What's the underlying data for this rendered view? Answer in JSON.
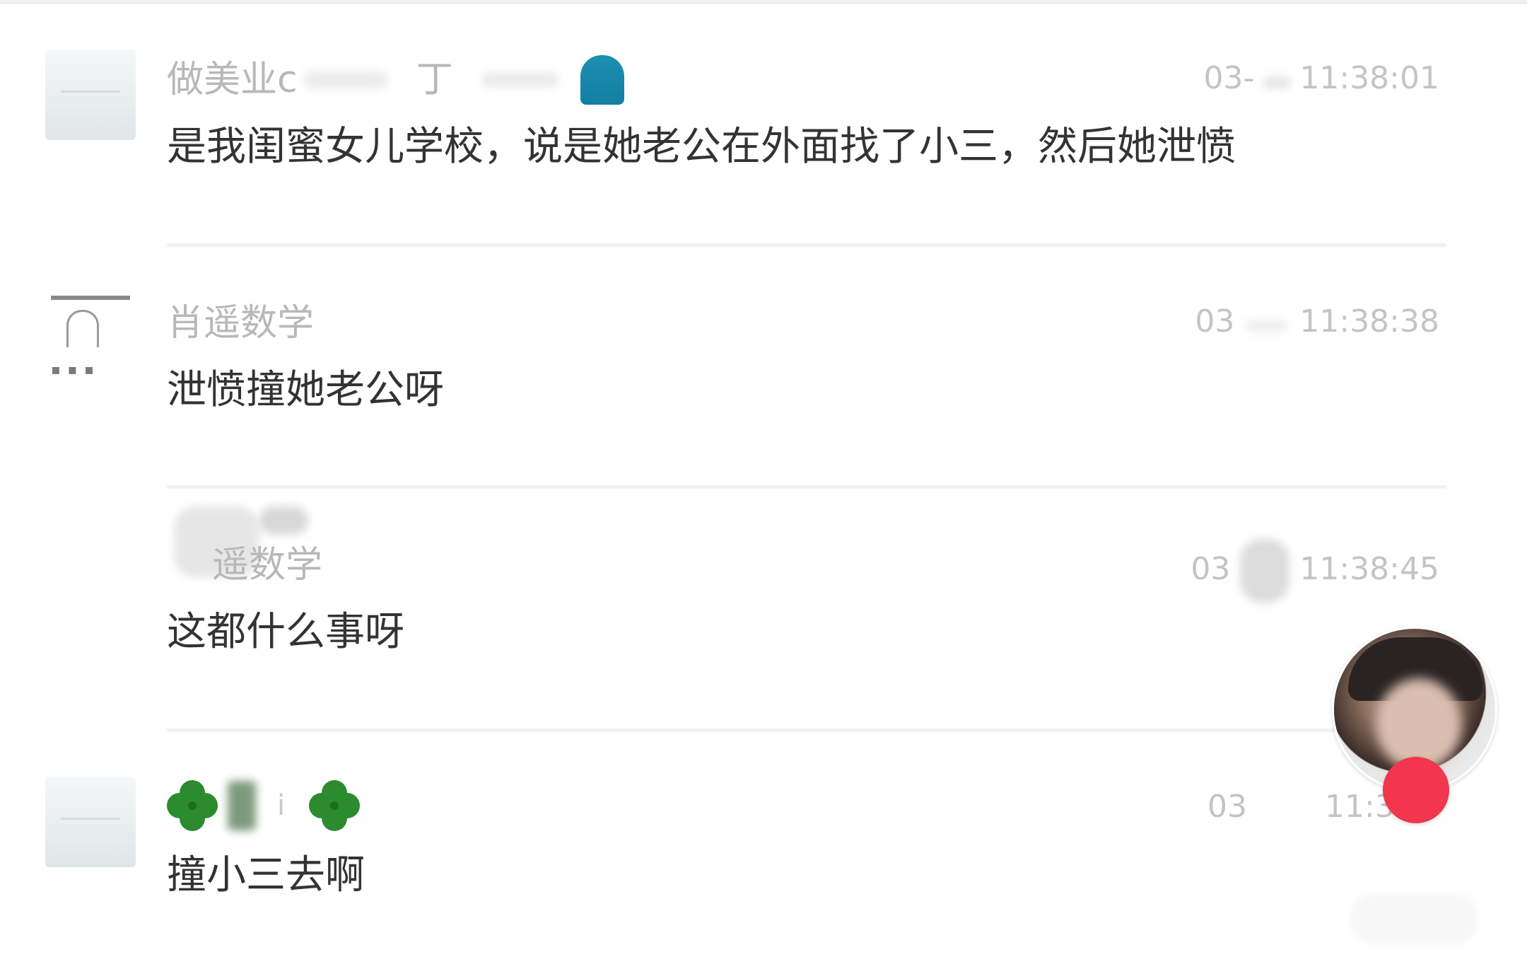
{
  "comments": [
    {
      "username": "做美业c",
      "username_tail": "丁",
      "timestamp": "03-",
      "timestamp_tail": "11:38:01",
      "text": "是我闺蜜女儿学校，说是她老公在外面找了小三，然后她泄愤"
    },
    {
      "username": "肖遥数学",
      "timestamp": "03",
      "timestamp_tail": "11:38:38",
      "text": "泄愤撞她老公呀"
    },
    {
      "username": "遥数学",
      "timestamp": "03",
      "timestamp_tail": "11:38:45",
      "text": "这都什么事呀"
    },
    {
      "username": "i",
      "timestamp": "03",
      "timestamp_tail": "11:3",
      "text": "撞小三去啊"
    }
  ],
  "icons": {
    "wave": "wave-emoji-icon",
    "clover": "four-leaf-clover-icon"
  },
  "colors": {
    "username": "#b8b8b8",
    "text": "#333333",
    "timestamp": "#c4c4c4",
    "follow": "#f2364e"
  }
}
